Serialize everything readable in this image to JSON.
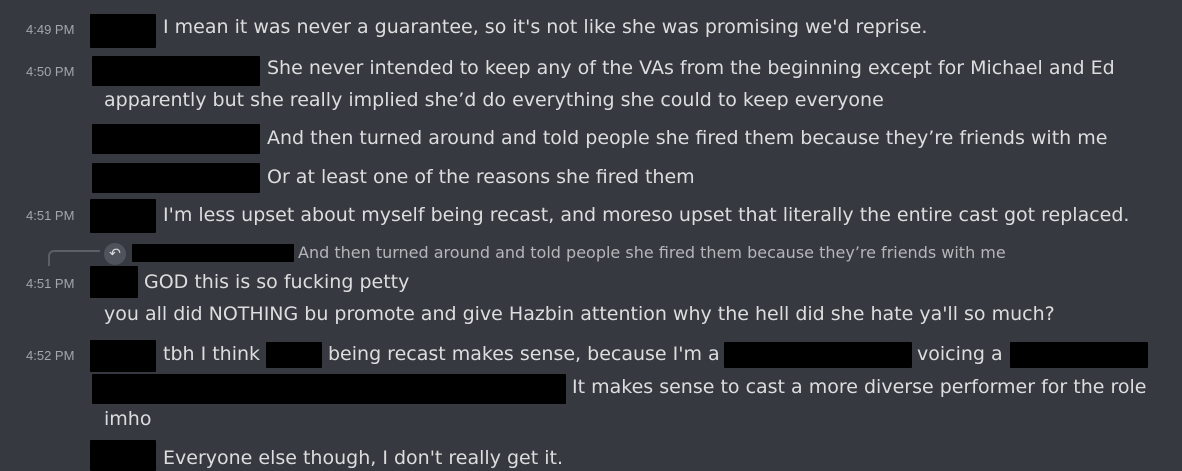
{
  "messages": [
    {
      "time": "4:49 PM",
      "lines": [
        "I mean it was never a guarantee, so it's not like she was promising we'd reprise."
      ]
    },
    {
      "time": "4:50 PM",
      "lines": [
        "She never intended to keep any of the VAs from the beginning except for Michael and Ed",
        "apparently but she really implied she’d do everything she could to keep everyone"
      ]
    },
    {
      "time": "",
      "lines": [
        "And then turned around and told people she fired them because they’re friends with me"
      ]
    },
    {
      "time": "",
      "lines": [
        "Or at least one of the reasons she fired them"
      ]
    },
    {
      "time": "4:51 PM",
      "lines": [
        "I'm less upset about myself being recast, and moreso upset that literally the entire cast got replaced."
      ]
    },
    {
      "reply_preview": "And then turned around and told people she fired them because they’re friends with me",
      "time": "4:51 PM",
      "lines": [
        "GOD this is so fucking petty",
        "you all did NOTHING bu promote and give Hazbin attention why the hell did she hate ya'll so much?"
      ]
    },
    {
      "time": "4:52 PM",
      "segments": [
        "tbh I think",
        "being recast makes sense, because I'm a",
        "voicing a"
      ],
      "lines": [
        "It makes sense to cast a more diverse performer for the role",
        "imho"
      ]
    },
    {
      "time": "",
      "lines": [
        "Everyone else though, I don't really get it."
      ]
    }
  ],
  "icons": {
    "reply": "reply-arrow-icon"
  },
  "colors": {
    "background": "#36393f",
    "text": "#dcddde",
    "timestamp": "#a3a6aa",
    "redaction": "#000000"
  }
}
